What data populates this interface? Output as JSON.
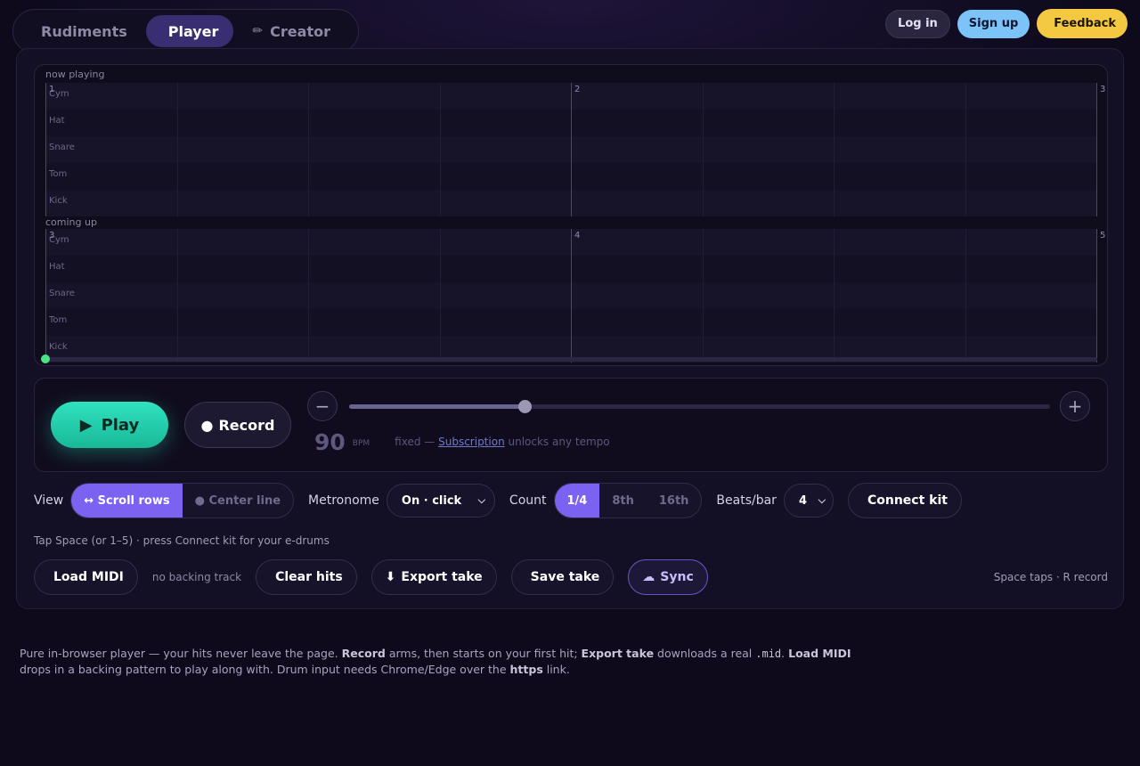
{
  "nav": {
    "tabs": [
      {
        "icon": "",
        "label": "Rudiments",
        "active": false
      },
      {
        "icon": "",
        "label": "Player",
        "active": true
      },
      {
        "icon": "✏",
        "label": "Creator",
        "active": false
      }
    ]
  },
  "auth": {
    "login": "Log in",
    "signup": "Sign up",
    "feedback_icon": "",
    "feedback": "Feedback"
  },
  "grid": {
    "now_label": "now playing",
    "next_label": "coming up",
    "lanes": [
      "Cym",
      "Hat",
      "Snare",
      "Tom",
      "Kick"
    ],
    "now_bars": [
      "1",
      "2",
      "3"
    ],
    "next_bars": [
      "3",
      "4",
      "5"
    ]
  },
  "transport": {
    "play_icon": "▶",
    "play": "Play",
    "record_icon": "●",
    "record": "Record",
    "minus": "−",
    "plus": "+",
    "tempo_fraction": 0.25,
    "lock_icon": "",
    "bpm": "90",
    "bpm_unit": "BPM",
    "lock2_icon": "",
    "note_icon": "",
    "note_prefix": "fixed —",
    "note_link": "Subscription",
    "note_suffix": "unlocks any tempo"
  },
  "options": {
    "view_label": "View",
    "view_items": [
      {
        "label": "↔ Scroll rows",
        "active": true
      },
      {
        "label": "● Center line",
        "active": false
      }
    ],
    "metronome_label": "Metronome",
    "metronome_value": "On · click",
    "count_label": "Count",
    "count_items": [
      {
        "label": "1/4",
        "active": true
      },
      {
        "label": "8th",
        "active": false
      },
      {
        "label": "16th",
        "active": false
      }
    ],
    "beats_label": "Beats/bar",
    "beats_value": "4",
    "connect_icon": "",
    "connect": "Connect kit"
  },
  "hint": "Tap Space (or 1–5) · press  Connect kit for your e-drums",
  "actions": {
    "load_icon": "",
    "load": "Load MIDI",
    "backing": "no backing track",
    "clear_icon": "",
    "clear": "Clear hits",
    "export_icon": "⬇",
    "export": "Export take",
    "save_icon": "",
    "save": "Save take",
    "sync_icon": "☁",
    "sync": "Sync",
    "shortcuts": "Space taps · R record"
  },
  "footer": {
    "t1": "Pure in-browser player — your hits never leave the page. ",
    "b1": "Record",
    "t2": " arms, then starts on your first hit; ",
    "b2": "Export take",
    "t3": " downloads a real ",
    "code": ".mid",
    "t4": ". ",
    "b3": "Load MIDI",
    "t5": " drops in a backing pattern to play along with. Drum input needs Chrome/Edge over the ",
    "b4": "https",
    "t6": " link."
  },
  "colors": {
    "accent": "#7b62f0",
    "play": "#2fe3c0",
    "feedback": "#f5c842",
    "signup": "#7cc4f7",
    "playhead": "#4be38a"
  }
}
